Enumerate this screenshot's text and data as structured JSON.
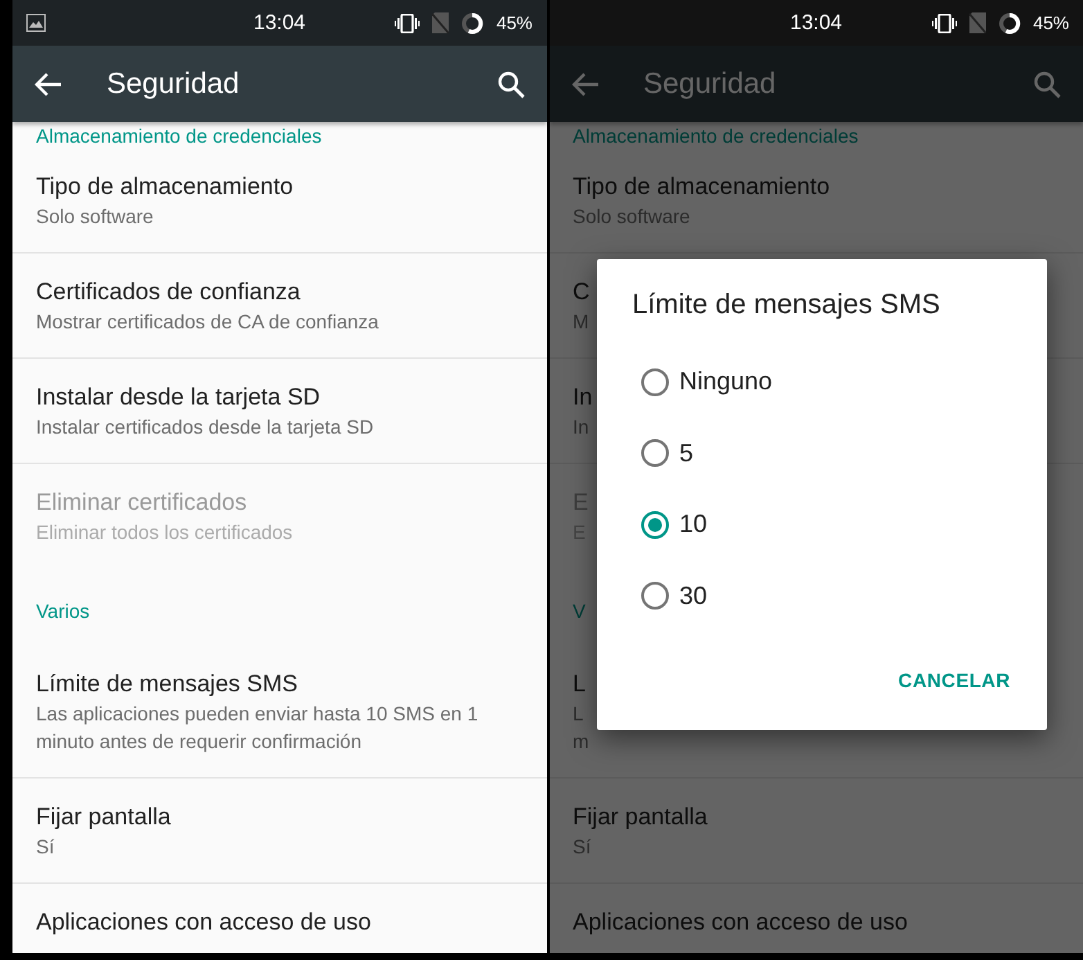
{
  "panes": [
    {
      "status_bar": {
        "time": "13:04",
        "battery": "45%",
        "notification": true
      },
      "toolbar": {
        "title": "Seguridad"
      },
      "dialog_open": false,
      "sections": [
        {
          "header": "Almacenamiento de credenciales",
          "items": [
            {
              "title": "Tipo de almacenamiento",
              "subtitle": "Solo software",
              "disabled": false
            },
            {
              "title": "Certificados de confianza",
              "subtitle": "Mostrar certificados de CA de confianza",
              "disabled": false
            },
            {
              "title": "Instalar desde la tarjeta SD",
              "subtitle": "Instalar certificados desde la tarjeta SD",
              "disabled": false
            },
            {
              "title": "Eliminar certificados",
              "subtitle": "Eliminar todos los certificados",
              "disabled": true
            }
          ]
        },
        {
          "header": "Varios",
          "items": [
            {
              "title": "Límite de mensajes SMS",
              "subtitle": "Las aplicaciones pueden enviar hasta 10 SMS en 1 minuto antes de requerir confirmación",
              "disabled": false
            },
            {
              "title": "Fijar pantalla",
              "subtitle": "Sí",
              "disabled": false
            },
            {
              "title": "Aplicaciones con acceso de uso",
              "disabled": false
            }
          ]
        }
      ]
    },
    {
      "status_bar": {
        "time": "13:04",
        "battery": "45%",
        "notification": false
      },
      "toolbar": {
        "title": "Seguridad"
      },
      "dialog_open": true,
      "sections": [
        {
          "header": "Almacenamiento de credenciales",
          "items": [
            {
              "title": "Tipo de almacenamiento",
              "subtitle": "Solo software",
              "disabled": false
            },
            {
              "title": "C",
              "subtitle": "M",
              "disabled": false
            },
            {
              "title": "In",
              "subtitle": "In",
              "disabled": false
            },
            {
              "title": "E",
              "subtitle": "E",
              "disabled": true
            }
          ]
        },
        {
          "header": "V",
          "items": [
            {
              "title": "L",
              "subtitle": "L\nm",
              "disabled": false
            },
            {
              "title": "Fijar pantalla",
              "subtitle": "Sí",
              "disabled": false
            },
            {
              "title": "Aplicaciones con acceso de uso",
              "disabled": false
            }
          ]
        }
      ],
      "dialog": {
        "title": "Límite de mensajes SMS",
        "options": [
          {
            "label": "Ninguno",
            "selected": false
          },
          {
            "label": "5",
            "selected": false
          },
          {
            "label": "10",
            "selected": true
          },
          {
            "label": "30",
            "selected": false
          }
        ],
        "action": "CANCELAR"
      }
    }
  ]
}
